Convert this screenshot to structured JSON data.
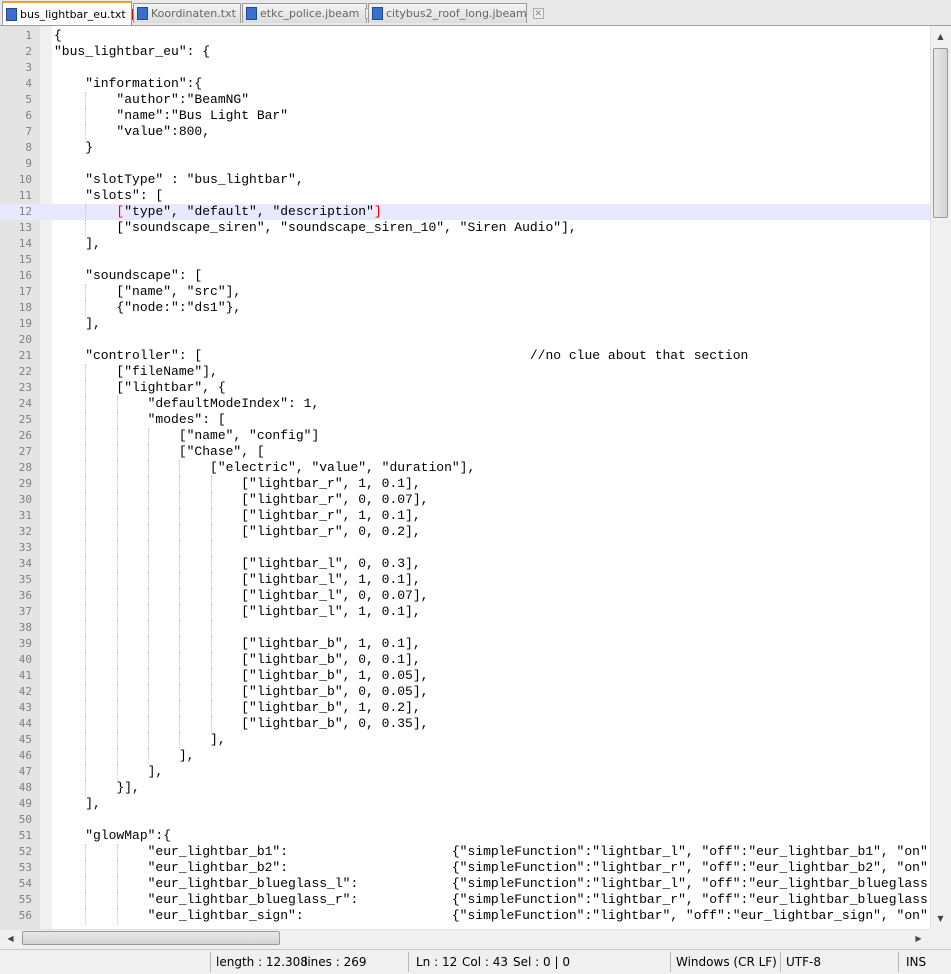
{
  "tabs": [
    {
      "label": "bus_lightbar_eu.txt",
      "active": true
    },
    {
      "label": "Koordinaten.txt",
      "active": false
    },
    {
      "label": "etkc_police.jbeam",
      "active": false
    },
    {
      "label": "citybus2_roof_long.jbeam",
      "active": false
    }
  ],
  "editor": {
    "current_line": 12,
    "lines": [
      "{",
      "\"bus_lightbar_eu\": {",
      "",
      "    \"information\":{",
      "        \"author\":\"BeamNG\"",
      "        \"name\":\"Bus Light Bar\"",
      "        \"value\":800,",
      "    }",
      "",
      "    \"slotType\" : \"bus_lightbar\",",
      "    \"slots\": [",
      "        [\"type\", \"default\", \"description\"]",
      "        [\"soundscape_siren\", \"soundscape_siren_10\", \"Siren Audio\"],",
      "    ],",
      "",
      "    \"soundscape\": [",
      "        [\"name\", \"src\"],",
      "        {\"node:\":\"ds1\"},",
      "    ],",
      "",
      "    \"controller\": [                                          //no clue about that section",
      "        [\"fileName\"],",
      "        [\"lightbar\", {",
      "            \"defaultModeIndex\": 1,",
      "            \"modes\": [",
      "                [\"name\", \"config\"]",
      "                [\"Chase\", [",
      "                    [\"electric\", \"value\", \"duration\"],",
      "                        [\"lightbar_r\", 1, 0.1],",
      "                        [\"lightbar_r\", 0, 0.07],",
      "                        [\"lightbar_r\", 1, 0.1],",
      "                        [\"lightbar_r\", 0, 0.2],",
      "",
      "                        [\"lightbar_l\", 0, 0.3],",
      "                        [\"lightbar_l\", 1, 0.1],",
      "                        [\"lightbar_l\", 0, 0.07],",
      "                        [\"lightbar_l\", 1, 0.1],",
      "",
      "                        [\"lightbar_b\", 1, 0.1],",
      "                        [\"lightbar_b\", 0, 0.1],",
      "                        [\"lightbar_b\", 1, 0.05],",
      "                        [\"lightbar_b\", 0, 0.05],",
      "                        [\"lightbar_b\", 1, 0.2],",
      "                        [\"lightbar_b\", 0, 0.35],",
      "                    ],",
      "                ],",
      "            ],",
      "        }],",
      "    ],",
      "",
      "    \"glowMap\":{",
      "            \"eur_lightbar_b1\":                     {\"simpleFunction\":\"lightbar_l\", \"off\":\"eur_lightbar_b1\", \"on\"",
      "            \"eur_lightbar_b2\":                     {\"simpleFunction\":\"lightbar_r\", \"off\":\"eur_lightbar_b2\", \"on\"",
      "            \"eur_lightbar_blueglass_l\":            {\"simpleFunction\":\"lightbar_l\", \"off\":\"eur_lightbar_blueglass",
      "            \"eur_lightbar_blueglass_r\":            {\"simpleFunction\":\"lightbar_r\", \"off\":\"eur_lightbar_blueglass",
      "            \"eur_lightbar_sign\":                   {\"simpleFunction\":\"lightbar\", \"off\":\"eur_lightbar_sign\", \"on\""
    ]
  },
  "status": {
    "length": "length : 12.308",
    "lines": "lines : 269",
    "ln": "Ln : 12",
    "col": "Col : 43",
    "sel": "Sel : 0 | 0",
    "eol": "Windows (CR LF)",
    "encoding": "UTF-8",
    "mode": "INS"
  }
}
